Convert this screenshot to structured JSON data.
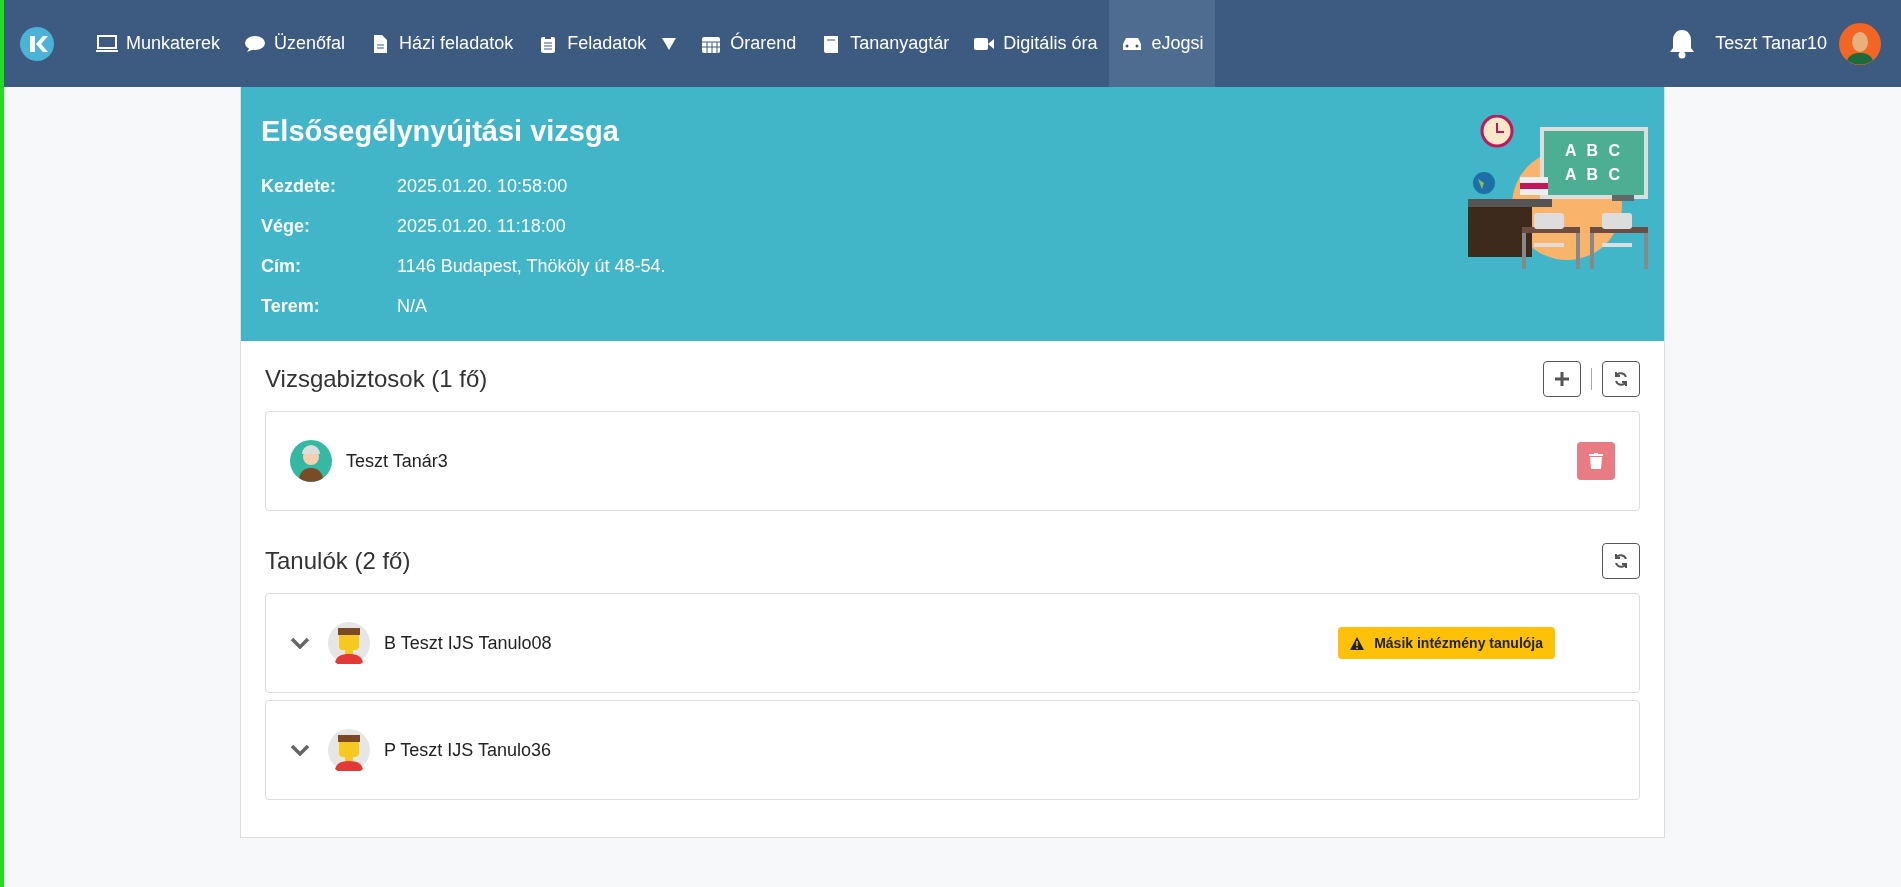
{
  "nav": {
    "items": [
      {
        "label": "Munkaterek",
        "selected": false,
        "dropdown": false
      },
      {
        "label": "Üzenőfal",
        "selected": false,
        "dropdown": false
      },
      {
        "label": "Házi feladatok",
        "selected": false,
        "dropdown": false
      },
      {
        "label": "Feladatok",
        "selected": false,
        "dropdown": true
      },
      {
        "label": "Órarend",
        "selected": false,
        "dropdown": false
      },
      {
        "label": "Tananyagtár",
        "selected": false,
        "dropdown": false
      },
      {
        "label": "Digitális óra",
        "selected": false,
        "dropdown": false
      },
      {
        "label": "eJogsi",
        "selected": true,
        "dropdown": false
      }
    ],
    "user": "Teszt Tanar10"
  },
  "exam": {
    "title": "Elsősegélynyújtási vizsga",
    "fields": [
      {
        "label": "Kezdete:",
        "value": "2025.01.20. 10:58:00"
      },
      {
        "label": "Vége:",
        "value": "2025.01.20. 11:18:00"
      },
      {
        "label": "Cím:",
        "value": "1146 Budapest, Thököly út 48-54."
      },
      {
        "label": "Terem:",
        "value": "N/A"
      }
    ],
    "board_lines": [
      "A B C",
      "A B C"
    ]
  },
  "examiners": {
    "title": "Vizsgabiztosok (1 fő)",
    "items": [
      {
        "name": "Teszt Tanár3"
      }
    ]
  },
  "students": {
    "title": "Tanulók (2 fő)",
    "items": [
      {
        "name": "B Teszt IJS Tanulo08",
        "expanded": false,
        "badge": "Másik intézmény tanulója"
      },
      {
        "name": "P Teszt IJS Tanulo36",
        "expanded": false
      }
    ]
  }
}
